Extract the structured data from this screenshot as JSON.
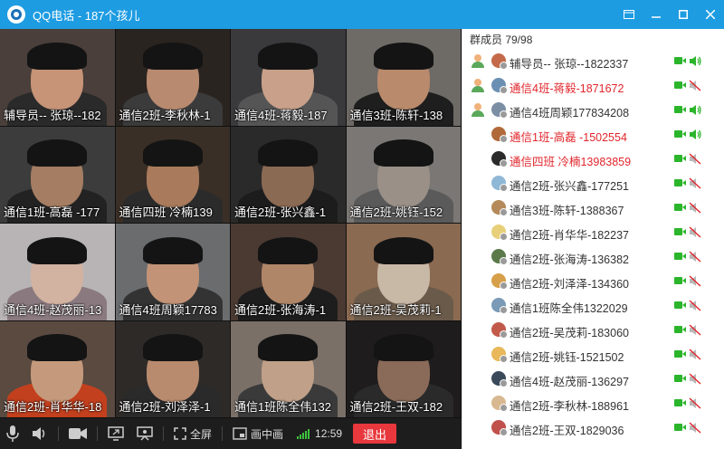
{
  "window": {
    "title": "QQ电话 - 187个孩儿",
    "controls": [
      "window-icon",
      "minimize-icon",
      "maximize-icon",
      "close-icon"
    ]
  },
  "video_tiles": [
    {
      "caption": "辅导员-- 张琼--182",
      "skin": "#c79478",
      "bg": "#4a3f3a",
      "shirt": "#2a2a2a"
    },
    {
      "caption": "通信2班-李秋林-1",
      "skin": "#b88a70",
      "bg": "#2a2420",
      "shirt": "#3b3b3b"
    },
    {
      "caption": "通信4班-蒋毅-187",
      "skin": "#c9a08a",
      "bg": "#3a3a3c",
      "shirt": "#555"
    },
    {
      "caption": "通信3班-陈轩-138",
      "skin": "#b98a6c",
      "bg": "#6e6a66",
      "shirt": "#1e1e1e"
    },
    {
      "caption": "通信1班-高磊 -177",
      "skin": "#a47d62",
      "bg": "#3c3c3c",
      "shirt": "#222"
    },
    {
      "caption": "通信四班 冷楠139",
      "skin": "#a97b5c",
      "bg": "#3a2f26",
      "shirt": "#2b2b2b"
    },
    {
      "caption": "通信2班-张兴鑫-1",
      "skin": "#8b6a54",
      "bg": "#2a2a2a",
      "shirt": "#1c1c1c"
    },
    {
      "caption": "通信2班-姚钰-152",
      "skin": "#9a9088",
      "bg": "#7a7774",
      "shirt": "#5a5a5a"
    },
    {
      "caption": "通信4班-赵茂丽-13",
      "skin": "#d2b2a0",
      "bg": "#b8b4b6",
      "shirt": "#8a7a80"
    },
    {
      "caption": "通信4班周颖17783",
      "skin": "#c29376",
      "bg": "#6a6c6e",
      "shirt": "#333"
    },
    {
      "caption": "通信2班-张海涛-1",
      "skin": "#b08668",
      "bg": "#4a3a32",
      "shirt": "#1d1d1d"
    },
    {
      "caption": "通信2班-吴茂莉-1",
      "skin": "#c8b8a6",
      "bg": "#8b6a52",
      "shirt": "#6a5a4a"
    },
    {
      "caption": "通信2班-肖华华-18",
      "skin": "#c59a7c",
      "bg": "#5a4a40",
      "shirt": "#c2401e"
    },
    {
      "caption": "通信2班-刘泽泽-1",
      "skin": "#b88a6e",
      "bg": "#2e2a28",
      "shirt": "#2a2a2a"
    },
    {
      "caption": "通信1班陈全伟132",
      "skin": "#c0a088",
      "bg": "#7a7068",
      "shirt": "#3a3a3a"
    },
    {
      "caption": "通信2班-王双-182",
      "skin": "#8a6a58",
      "bg": "#1e1c1c",
      "shirt": "#2a2a2a"
    }
  ],
  "toolbar": {
    "fullscreen_label": "全屏",
    "pip_label": "画中画",
    "time": "12:59",
    "exit_label": "退出"
  },
  "panel": {
    "header": "群成员 79/98",
    "members": [
      {
        "name": "辅导员-- 张琼--1822337",
        "red": false,
        "role": "admin",
        "avatar": "#c46a4a",
        "muted": false
      },
      {
        "name": "通信4班-蒋毅-1871672",
        "red": true,
        "role": "admin",
        "avatar": "#6b8fb3",
        "muted": true
      },
      {
        "name": "通信4班周颖177834208",
        "red": false,
        "role": "admin",
        "avatar": "#7c8ea3",
        "muted": false
      },
      {
        "name": "通信1班-高磊 -1502554",
        "red": true,
        "role": "",
        "avatar": "#b06a3a",
        "muted": false
      },
      {
        "name": "通信四班 冷楠13983859",
        "red": true,
        "role": "",
        "avatar": "#2b2b2b",
        "muted": true
      },
      {
        "name": "通信2班-张兴鑫-177251",
        "red": false,
        "role": "",
        "avatar": "#8fb8d6",
        "muted": true
      },
      {
        "name": "通信3班-陈轩-1388367",
        "red": false,
        "role": "",
        "avatar": "#b48a5a",
        "muted": true
      },
      {
        "name": "通信2班-肖华华-182237",
        "red": false,
        "role": "",
        "avatar": "#e8d07a",
        "muted": true
      },
      {
        "name": "通信2班-张海涛-136382",
        "red": false,
        "role": "",
        "avatar": "#5a7a4a",
        "muted": true
      },
      {
        "name": "通信2班-刘泽泽-134360",
        "red": false,
        "role": "",
        "avatar": "#d6a04a",
        "muted": true
      },
      {
        "name": "通信1班陈全伟1322029",
        "red": false,
        "role": "",
        "avatar": "#7a9ab8",
        "muted": true
      },
      {
        "name": "通信2班-吴茂莉-183060",
        "red": false,
        "role": "",
        "avatar": "#c25a4a",
        "muted": true
      },
      {
        "name": "通信2班-姚钰-1521502",
        "red": false,
        "role": "",
        "avatar": "#e8b85a",
        "muted": true
      },
      {
        "name": "通信4班-赵茂丽-136297",
        "red": false,
        "role": "",
        "avatar": "#3a4a5a",
        "muted": true
      },
      {
        "name": "通信2班-李秋林-188961",
        "red": false,
        "role": "",
        "avatar": "#d8b890",
        "muted": true
      },
      {
        "name": "通信2班-王双-1829036",
        "red": false,
        "role": "",
        "avatar": "#c0504a",
        "muted": true
      }
    ]
  },
  "colors": {
    "title_bar": "#1e9ce2",
    "highlight_name": "#e0262c",
    "active_green": "#2bb52b",
    "exit_red": "#e8383d"
  }
}
